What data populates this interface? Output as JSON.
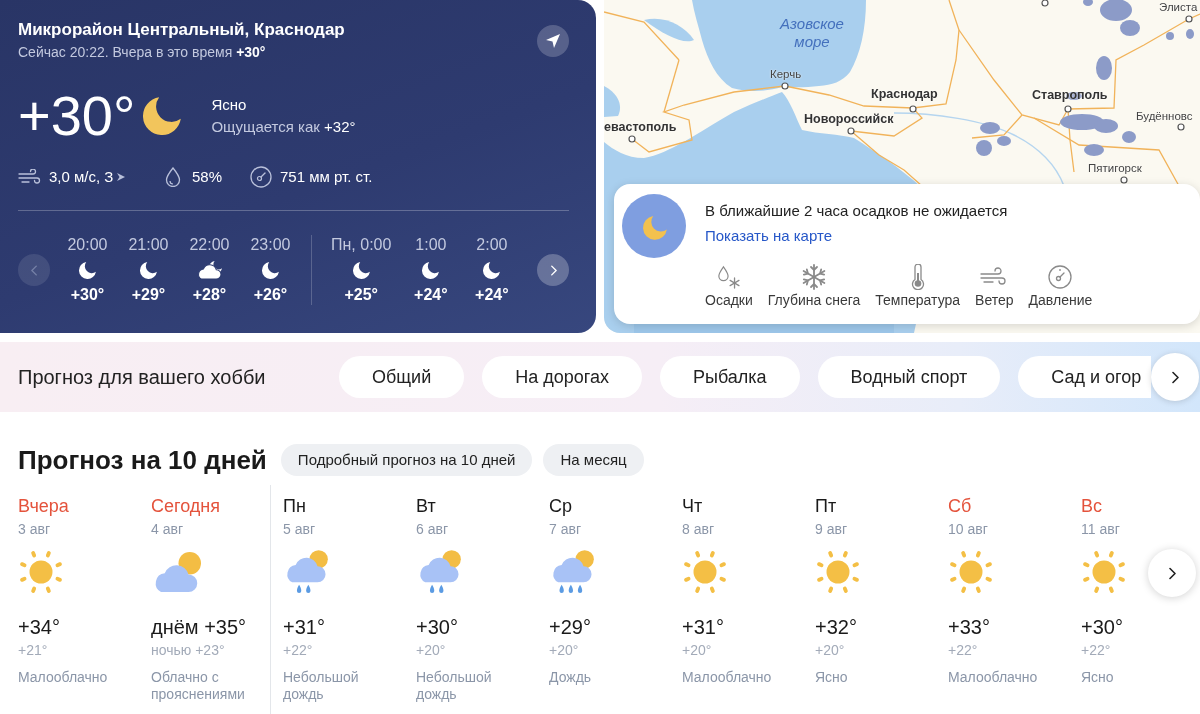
{
  "location_card": {
    "title": "Микрорайон Центральный, Краснодар",
    "subtitle": "Сейчас 20:22. Вчера в это время **+30°**",
    "temperature": "+30°",
    "condition": "Ясно",
    "feels_like": "Ощущается как **+32°**",
    "wind": "3,0 м/с, З",
    "humidity": "58%",
    "pressure": "751 мм рт. ст."
  },
  "hourly": {
    "prev": {
      "disabled": true
    },
    "next": {
      "disabled": false
    },
    "groups": [
      {
        "hours": [
          {
            "time": "20:00",
            "kind": "clear",
            "temperature": "+30°"
          },
          {
            "time": "21:00",
            "kind": "clear",
            "temperature": "+29°"
          },
          {
            "time": "22:00",
            "kind": "partly_cloudy",
            "temperature": "+28°"
          },
          {
            "time": "23:00",
            "kind": "clear",
            "temperature": "+26°"
          }
        ]
      },
      {
        "hours": [
          {
            "time": "Пн, 0:00",
            "kind": "clear",
            "temperature": "+25°"
          },
          {
            "time": "1:00",
            "kind": "clear",
            "temperature": "+24°"
          },
          {
            "time": "2:00",
            "kind": "clear",
            "temperature": "+24°"
          }
        ]
      }
    ]
  },
  "map": {
    "labels": [
      {
        "text": "Элиста",
        "kind": "city"
      },
      {
        "text": "Азовское море",
        "kind": "sea"
      },
      {
        "text": "Керчь",
        "kind": "city"
      },
      {
        "text": "Краснодар",
        "kind": "major_city"
      },
      {
        "text": "Ставрополь",
        "kind": "major_city"
      },
      {
        "text": "Будённовс",
        "kind": "city"
      },
      {
        "text": "Новороссийск",
        "kind": "major_city"
      },
      {
        "text": "евастополь",
        "kind": "major_city"
      },
      {
        "text": "Пятигорск",
        "kind": "city"
      }
    ]
  },
  "nowcast": {
    "message": "В ближайшие 2 часа осадков не ожидается",
    "link": "Показать на карте",
    "layers": [
      {
        "kind": "precipitation",
        "label": "Осадки"
      },
      {
        "kind": "snow",
        "label": "Глубина снега"
      },
      {
        "kind": "temperature",
        "label": "Температура"
      },
      {
        "kind": "wind",
        "label": "Ветер"
      },
      {
        "kind": "pressure",
        "label": "Давление"
      }
    ]
  },
  "hobby": {
    "title": "Прогноз для вашего хобби",
    "options": [
      "Общий",
      "На дорогах",
      "Рыбалка",
      "Водный спорт",
      "Сад и огор"
    ]
  },
  "forecast": {
    "title": "Прогноз на 10 дней",
    "links": [
      "Подробный прогноз на 10 дней",
      "На месяц"
    ],
    "groups": [
      {
        "days": [
          {
            "day": "Вчера",
            "highlighted": true,
            "date": "3 авг",
            "kind": "sunny",
            "day_temperature": "+34°",
            "night_temperature": "+21°",
            "condition": "Малооблачно"
          },
          {
            "day": "Сегодня",
            "highlighted": true,
            "date": "4 авг",
            "kind": "partly_cloudy",
            "day_temperature": "днём +35°",
            "night_temperature": "ночью +23°",
            "condition": "Облачно с прояснениями"
          }
        ]
      },
      {
        "days": [
          {
            "day": "Пн",
            "highlighted": false,
            "date": "5 авг",
            "kind": "light_rain",
            "day_temperature": "+31°",
            "night_temperature": "+22°",
            "condition": "Небольшой дождь"
          },
          {
            "day": "Вт",
            "highlighted": false,
            "date": "6 авг",
            "kind": "light_rain",
            "day_temperature": "+30°",
            "night_temperature": "+20°",
            "condition": "Небольшой дождь"
          },
          {
            "day": "Ср",
            "highlighted": false,
            "date": "7 авг",
            "kind": "rain",
            "day_temperature": "+29°",
            "night_temperature": "+20°",
            "condition": "Дождь"
          },
          {
            "day": "Чт",
            "highlighted": false,
            "date": "8 авг",
            "kind": "sunny",
            "day_temperature": "+31°",
            "night_temperature": "+20°",
            "condition": "Малооблачно"
          },
          {
            "day": "Пт",
            "highlighted": false,
            "date": "9 авг",
            "kind": "sunny",
            "day_temperature": "+32°",
            "night_temperature": "+20°",
            "condition": "Ясно"
          },
          {
            "day": "Сб",
            "highlighted": true,
            "date": "10 авг",
            "kind": "sunny",
            "day_temperature": "+33°",
            "night_temperature": "+22°",
            "condition": "Малооблачно"
          },
          {
            "day": "Вс",
            "highlighted": true,
            "date": "11 авг",
            "kind": "sunny",
            "day_temperature": "+30°",
            "night_temperature": "+22°",
            "condition": "Ясно"
          }
        ]
      }
    ]
  }
}
